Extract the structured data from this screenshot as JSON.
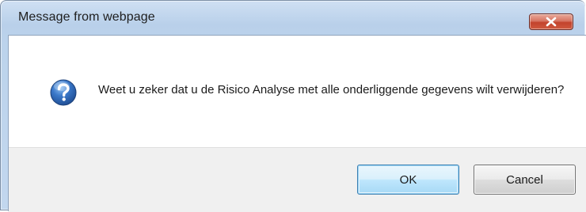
{
  "window": {
    "title": "Message from webpage"
  },
  "dialog": {
    "icon": "question-icon",
    "message": "Weet u zeker dat u de Risico Analyse met alle onderliggende gegevens wilt verwijderen?"
  },
  "buttons": {
    "ok_label": "OK",
    "cancel_label": "Cancel"
  },
  "colors": {
    "close_button": "#c9503a",
    "icon_blue": "#2a5ea8",
    "ok_border": "#3c7fb1"
  }
}
